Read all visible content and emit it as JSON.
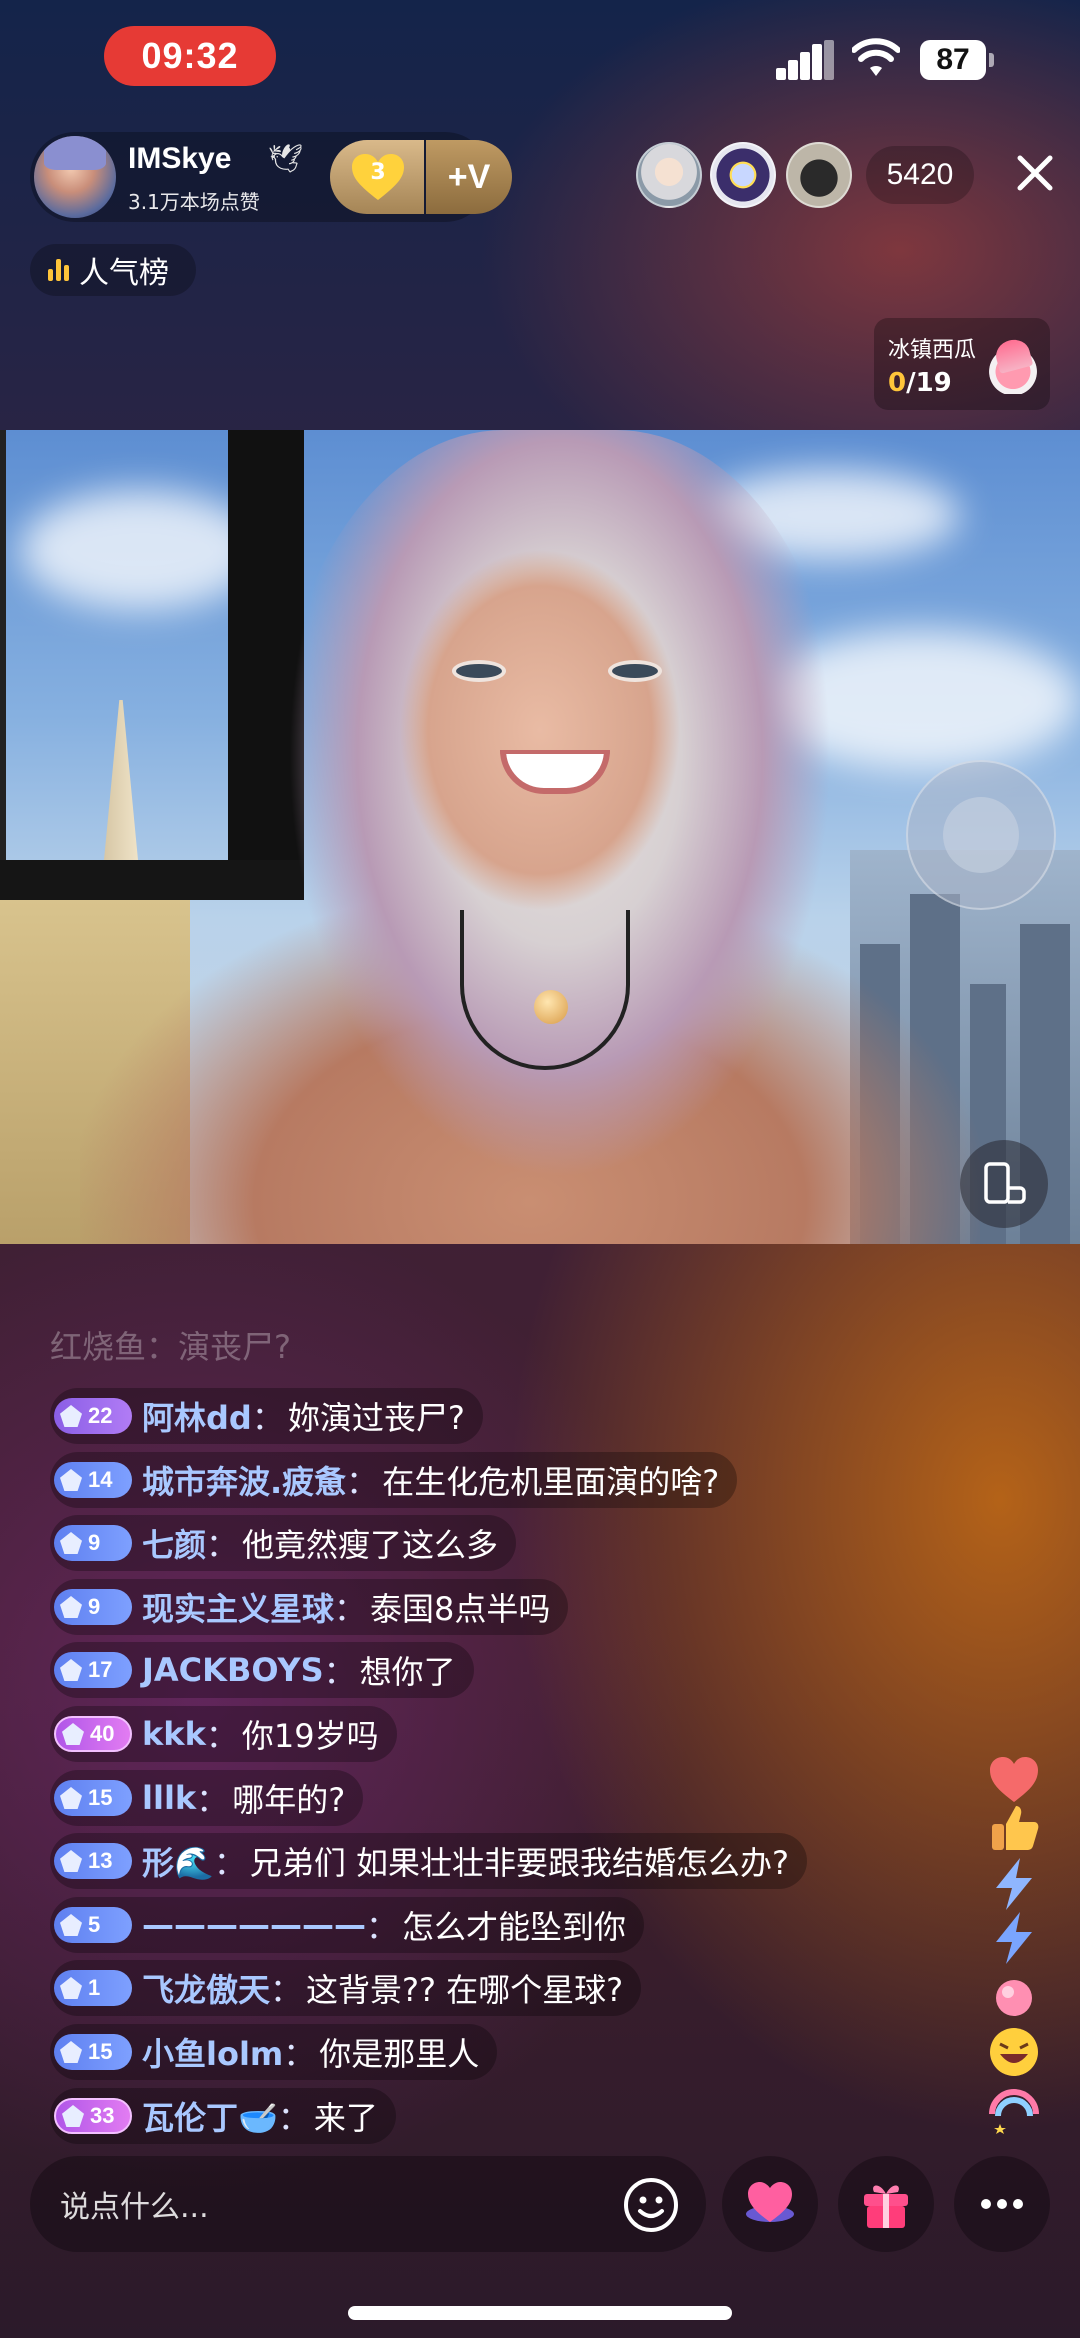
{
  "status_bar": {
    "time": "09:32",
    "battery": "87"
  },
  "host": {
    "name": "IMSkye",
    "likes": "3.1万本场点赞",
    "fan_level": "3",
    "follow_label": "+V"
  },
  "viewers": {
    "count": "5420"
  },
  "ranking": {
    "label": "人气榜"
  },
  "task": {
    "title": "冰镇西瓜",
    "current": "0",
    "total": "/19"
  },
  "chat": {
    "faded": {
      "user": "红烧鱼",
      "text": "演丧尸?"
    },
    "messages": [
      {
        "level": "22",
        "tier": "purple",
        "user": "阿林dd",
        "text": "妳演过丧尸?"
      },
      {
        "level": "14",
        "tier": "blue",
        "user": "城市奔波.疲惫",
        "text": "在生化危机里面演的啥?"
      },
      {
        "level": "9",
        "tier": "blue",
        "user": "七颜",
        "text": "他竟然瘦了这么多"
      },
      {
        "level": "9",
        "tier": "blue",
        "user": "现实主义星球",
        "text": "泰国8点半吗"
      },
      {
        "level": "17",
        "tier": "blue",
        "user": "JACKBOYS",
        "text": "想你了"
      },
      {
        "level": "40",
        "tier": "pink",
        "user": "kkk",
        "text": "你19岁吗"
      },
      {
        "level": "15",
        "tier": "blue",
        "user": "lllk",
        "text": "哪年的?"
      },
      {
        "level": "13",
        "tier": "blue",
        "user": "形🌊",
        "text": "兄弟们 如果壮壮非要跟我结婚怎么办?"
      },
      {
        "level": "5",
        "tier": "blue",
        "user": "———————",
        "text": "怎么才能坠到你"
      },
      {
        "level": "1",
        "tier": "blue",
        "user": "飞龙傲天",
        "text": "这背景?? 在哪个星球?"
      },
      {
        "level": "15",
        "tier": "blue",
        "user": "小鱼lolm",
        "text": "你是那里人"
      },
      {
        "level": "33",
        "tier": "pink",
        "user": "瓦伦丁🥣",
        "text": "来了"
      }
    ]
  },
  "input": {
    "placeholder": "说点什么..."
  },
  "icons": [
    "bird-icon",
    "heart-badge-icon",
    "close-icon",
    "ranking-bars-icon",
    "watermelon-icon",
    "joystick-icon",
    "rotate-screen-icon",
    "emoji-icon",
    "like-heart-icon",
    "gift-icon",
    "more-icon"
  ],
  "colors": {
    "accent_red": "#e63a35",
    "gold": "#ffc53a",
    "username_blue": "#a9c8ff"
  }
}
